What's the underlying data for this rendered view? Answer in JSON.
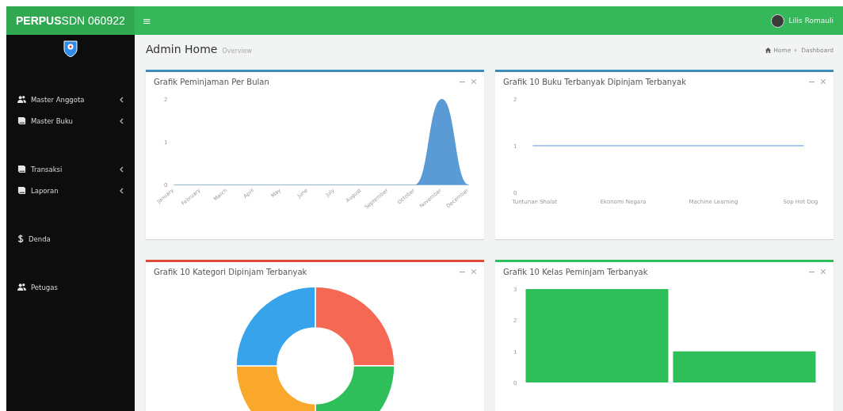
{
  "header": {
    "brand_bold": "PERPUS",
    "brand_light": "SDN 060922",
    "menu_toggle": "≡",
    "user_name": "Lilis Romauli"
  },
  "sidebar": {
    "groups": [
      {
        "items": [
          {
            "label": "Master Anggota",
            "kind": "users",
            "has_submenu": true
          },
          {
            "label": "Master Buku",
            "kind": "book",
            "has_submenu": true
          }
        ]
      },
      {
        "items": [
          {
            "label": "Transaksi",
            "kind": "book",
            "has_submenu": true
          },
          {
            "label": "Laporan",
            "kind": "book",
            "has_submenu": true
          }
        ]
      },
      {
        "items": [
          {
            "label": "Denda",
            "kind": "dollar",
            "has_submenu": false
          }
        ]
      },
      {
        "items": [
          {
            "label": "Petugas",
            "kind": "users",
            "has_submenu": false
          }
        ]
      }
    ]
  },
  "page": {
    "title": "Admin Home",
    "subtitle": "Overview",
    "breadcrumb": [
      "Home",
      "Dashboard"
    ]
  },
  "boxes": [
    {
      "title": "Grafik Peminjaman Per Bulan",
      "color": "#3c8dbc",
      "chart_data": {
        "type": "area",
        "categories": [
          "January",
          "February",
          "March",
          "April",
          "May",
          "June",
          "July",
          "August",
          "September",
          "October",
          "November",
          "December"
        ],
        "series": [
          {
            "color": "#5b9bd5",
            "values": [
              0,
              0,
              0,
              0,
              0,
              0,
              0,
              0,
              0,
              0,
              2,
              0
            ]
          }
        ],
        "ylim": [
          0,
          2
        ],
        "yticks": [
          0,
          1,
          2
        ]
      }
    },
    {
      "title": "Grafik 10 Buku Terbanyak Dipinjam Terbanyak",
      "color": "#3c8dbc",
      "chart_data": {
        "type": "line",
        "categories": [
          "Tuntunan Shalat",
          "Ekonomi Negara",
          "Machine Learning",
          "Sop Hot Dog"
        ],
        "series": [
          {
            "color": "#5b9bd5",
            "values": [
              1,
              1,
              1,
              1
            ]
          }
        ],
        "ylim": [
          0,
          2
        ],
        "yticks": [
          0,
          1,
          2
        ]
      }
    },
    {
      "title": "Grafik 10 Kategori Dipinjam Terbanyak",
      "color": "#dd4b39"
    },
    {
      "title": "Grafik 10 Kelas Peminjam Terbanyak",
      "color": "#2fbf5a",
      "chart_data": {
        "type": "bar",
        "series": [
          {
            "color": "#2fbf5a",
            "values": [
              3,
              1
            ]
          }
        ],
        "ylim": [
          0,
          3
        ],
        "yticks": [
          0,
          1,
          2,
          3
        ]
      }
    }
  ]
}
